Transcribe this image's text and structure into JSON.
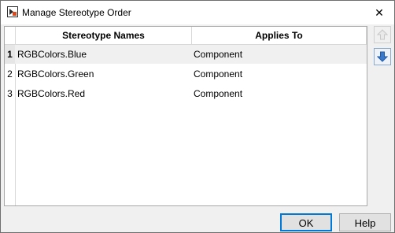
{
  "window": {
    "title": "Manage Stereotype Order",
    "close_glyph": "✕"
  },
  "table": {
    "columns": [
      "Stereotype Names",
      "Applies To"
    ],
    "rows": [
      {
        "index": "1",
        "name": "RGBColors.Blue",
        "applies_to": "Component",
        "selected": true
      },
      {
        "index": "2",
        "name": "RGBColors.Green",
        "applies_to": "Component",
        "selected": false
      },
      {
        "index": "3",
        "name": "RGBColors.Red",
        "applies_to": "Component",
        "selected": false
      }
    ]
  },
  "side_buttons": {
    "move_up_icon": "arrow-up-icon",
    "move_down_icon": "arrow-down-icon",
    "move_up_enabled": false,
    "move_down_enabled": true
  },
  "footer": {
    "ok_label": "OK",
    "help_label": "Help"
  },
  "colors": {
    "selected_row": "#f0f0f0",
    "arrow_enabled": "#3a78c9",
    "arrow_disabled": "#c8c8c8"
  }
}
